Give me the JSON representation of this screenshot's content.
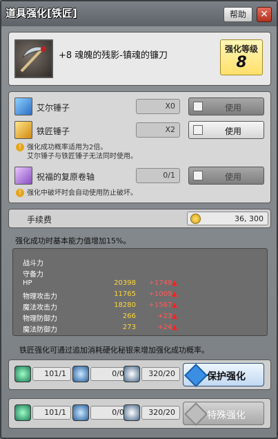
{
  "window": {
    "title": "道具强化[铁匠]",
    "help_label": "帮助",
    "close_label": "✕"
  },
  "item": {
    "name": "+8  魂魄的残影-镇魂的镰刀",
    "level_label": "强化等级",
    "level_value": "8"
  },
  "materials": [
    {
      "name": "艾尔锤子",
      "count": "X0",
      "use_label": "使用",
      "icon": "blue-hammer-icon",
      "active": false
    },
    {
      "name": "铁匠锤子",
      "count": "X2",
      "use_label": "使用",
      "icon": "gold-hammer-icon",
      "active": true
    },
    {
      "name": "祝福的复原卷轴",
      "count": "0/1",
      "use_label": "使用",
      "icon": "scroll-icon",
      "active": false
    }
  ],
  "notes": {
    "hammer_line1": "强化成功概率适用为2倍。",
    "hammer_line2": "艾尔锤子与铁匠锤子无法同时使用。",
    "scroll": "强化中破坏时会自动使用防止破坏。"
  },
  "fee": {
    "label": "手续费",
    "amount": "36, 300",
    "icon": "gold-coin-icon"
  },
  "info_text": "强化成功时基本能力值增加15%。",
  "stats": [
    {
      "label": "战斗力",
      "value": "",
      "bonus": ""
    },
    {
      "label": "守备力",
      "value": "",
      "bonus": ""
    },
    {
      "label": "HP",
      "value": "20398",
      "bonus": "+1749"
    },
    {
      "label": "物理攻击力",
      "value": "11765",
      "bonus": "+1009"
    },
    {
      "label": "魔法攻击力",
      "value": "18280",
      "bonus": "+1567"
    },
    {
      "label": "物理防御力",
      "value": "266",
      "bonus": "+23"
    },
    {
      "label": "魔法防御力",
      "value": "273",
      "bonus": "+24"
    }
  ],
  "hint_text": "铁匠强化可通过追加消耗硬化秘银来增加强化成功概率。",
  "actions": [
    {
      "slots": [
        {
          "icon": "green-crystal-icon",
          "count": "101/1"
        },
        {
          "icon": "blue-crystal-icon",
          "count": "0/0"
        },
        {
          "icon": "white-crystal-icon",
          "count": "320/20"
        }
      ],
      "button": "保护强化",
      "enabled": true
    },
    {
      "slots": [
        {
          "icon": "green-crystal-icon",
          "count": "101/1"
        },
        {
          "icon": "blue-crystal-icon",
          "count": "0/0"
        },
        {
          "icon": "white-crystal-icon",
          "count": "320/20"
        }
      ],
      "button": "特殊强化",
      "enabled": false
    }
  ],
  "colors": {
    "accent_blue": "#3a8ee4",
    "stat_value": "#ffd836",
    "stat_bonus": "#ff5a5a",
    "level_box": "#ffe06a"
  }
}
